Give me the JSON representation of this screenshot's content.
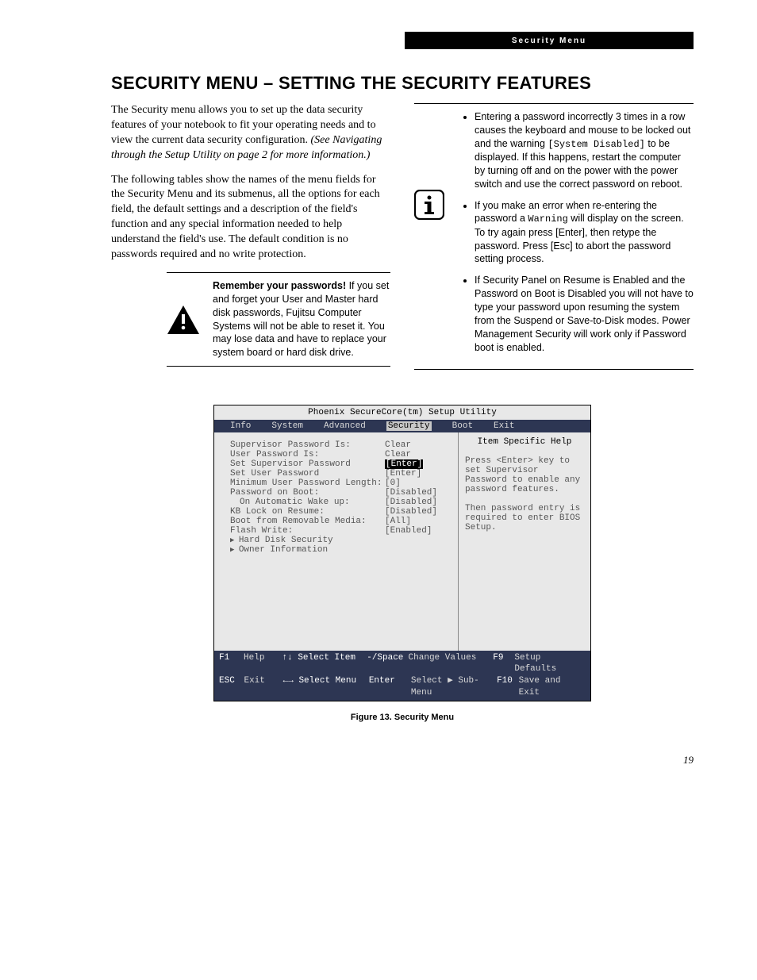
{
  "header": {
    "label": "Security Menu"
  },
  "title": "SECURITY MENU – SETTING THE SECURITY FEATURES",
  "intro1a": "The Security menu allows you to set up the data security features of your notebook to fit your operating needs and to view the current data security configuration. ",
  "intro1b": "(See Navigating through the Setup Utility on page 2 for more information.)",
  "intro2": "The following tables show the names of the menu fields for the Security Menu and its submenus, all the options for each field, the default settings and a description of the field's function and any special information needed to help understand the field's use. The default condition is no passwords required and no write protection.",
  "warn_bold": "Remember your passwords!",
  "warn_text": " If you set and forget your User and Master hard disk passwords, Fujitsu Computer Systems will not be able to reset it. You may lose data and have to replace your system board or hard disk drive.",
  "info1a": "Entering a password incorrectly 3 times in a row causes the keyboard and mouse to be locked out and the warning ",
  "info1_code": "[System Disabled]",
  "info1b": " to be displayed. If this happens, restart the computer by turning off and on the power with the power switch and use the correct password on reboot.",
  "info2a": "If you make an error when re-entering the password a ",
  "info2_code": "Warning",
  "info2b": " will display on the screen. To try again press [Enter], then retype the password. Press [Esc] to abort the password setting process.",
  "info3": "If Security Panel on Resume is Enabled and the Password on Boot is Disabled you will not have to type your password upon resuming the system from the Suspend or Save-to-Disk modes. Power Management Security will work only if Password boot is enabled.",
  "bios": {
    "title": "Phoenix SecureCore(tm) Setup Utility",
    "menu": [
      "Info",
      "System",
      "Advanced",
      "Security",
      "Boot",
      "Exit"
    ],
    "rows": [
      {
        "lbl": "Supervisor Password Is:",
        "val": "Clear"
      },
      {
        "lbl": "User Password Is:",
        "val": "Clear"
      },
      {
        "lbl": "",
        "val": ""
      },
      {
        "lbl": "Set Supervisor Password",
        "val": "[Enter]",
        "sel": true
      },
      {
        "lbl": "Set User Password",
        "val": "[Enter]"
      },
      {
        "lbl": "Minimum User Password Length:",
        "val": "[0]"
      },
      {
        "lbl": "Password on Boot:",
        "val": "[Disabled]"
      },
      {
        "lbl": "On Automatic Wake up:",
        "val": "[Disabled]",
        "indent": true
      },
      {
        "lbl": "KB Lock on Resume:",
        "val": "[Disabled]"
      },
      {
        "lbl": "Boot from Removable Media:",
        "val": "[All]"
      },
      {
        "lbl": "Flash Write:",
        "val": "[Enabled]"
      },
      {
        "lbl": "Hard Disk Security",
        "val": "",
        "sub": true
      },
      {
        "lbl": "Owner Information",
        "val": "",
        "sub": true
      }
    ],
    "help_title": "Item Specific Help",
    "help_body": "Press <Enter> key to set Supervisor Password to enable any password features.\n\nThen password entry is required to enter BIOS Setup.",
    "foot": {
      "f1": "F1",
      "help": "Help",
      "ud": "↑↓ Select Item",
      "sp": "-/Space",
      "cv": "Change Values",
      "f9": "F9",
      "sd": "Setup Defaults",
      "esc": "ESC",
      "exit": "Exit",
      "lr": "←→ Select Menu",
      "en": "Enter",
      "ss": "Select ▶ Sub-Menu",
      "f10": "F10",
      "se": "Save and Exit"
    }
  },
  "caption": "Figure 13.  Security Menu",
  "pagenum": "19"
}
